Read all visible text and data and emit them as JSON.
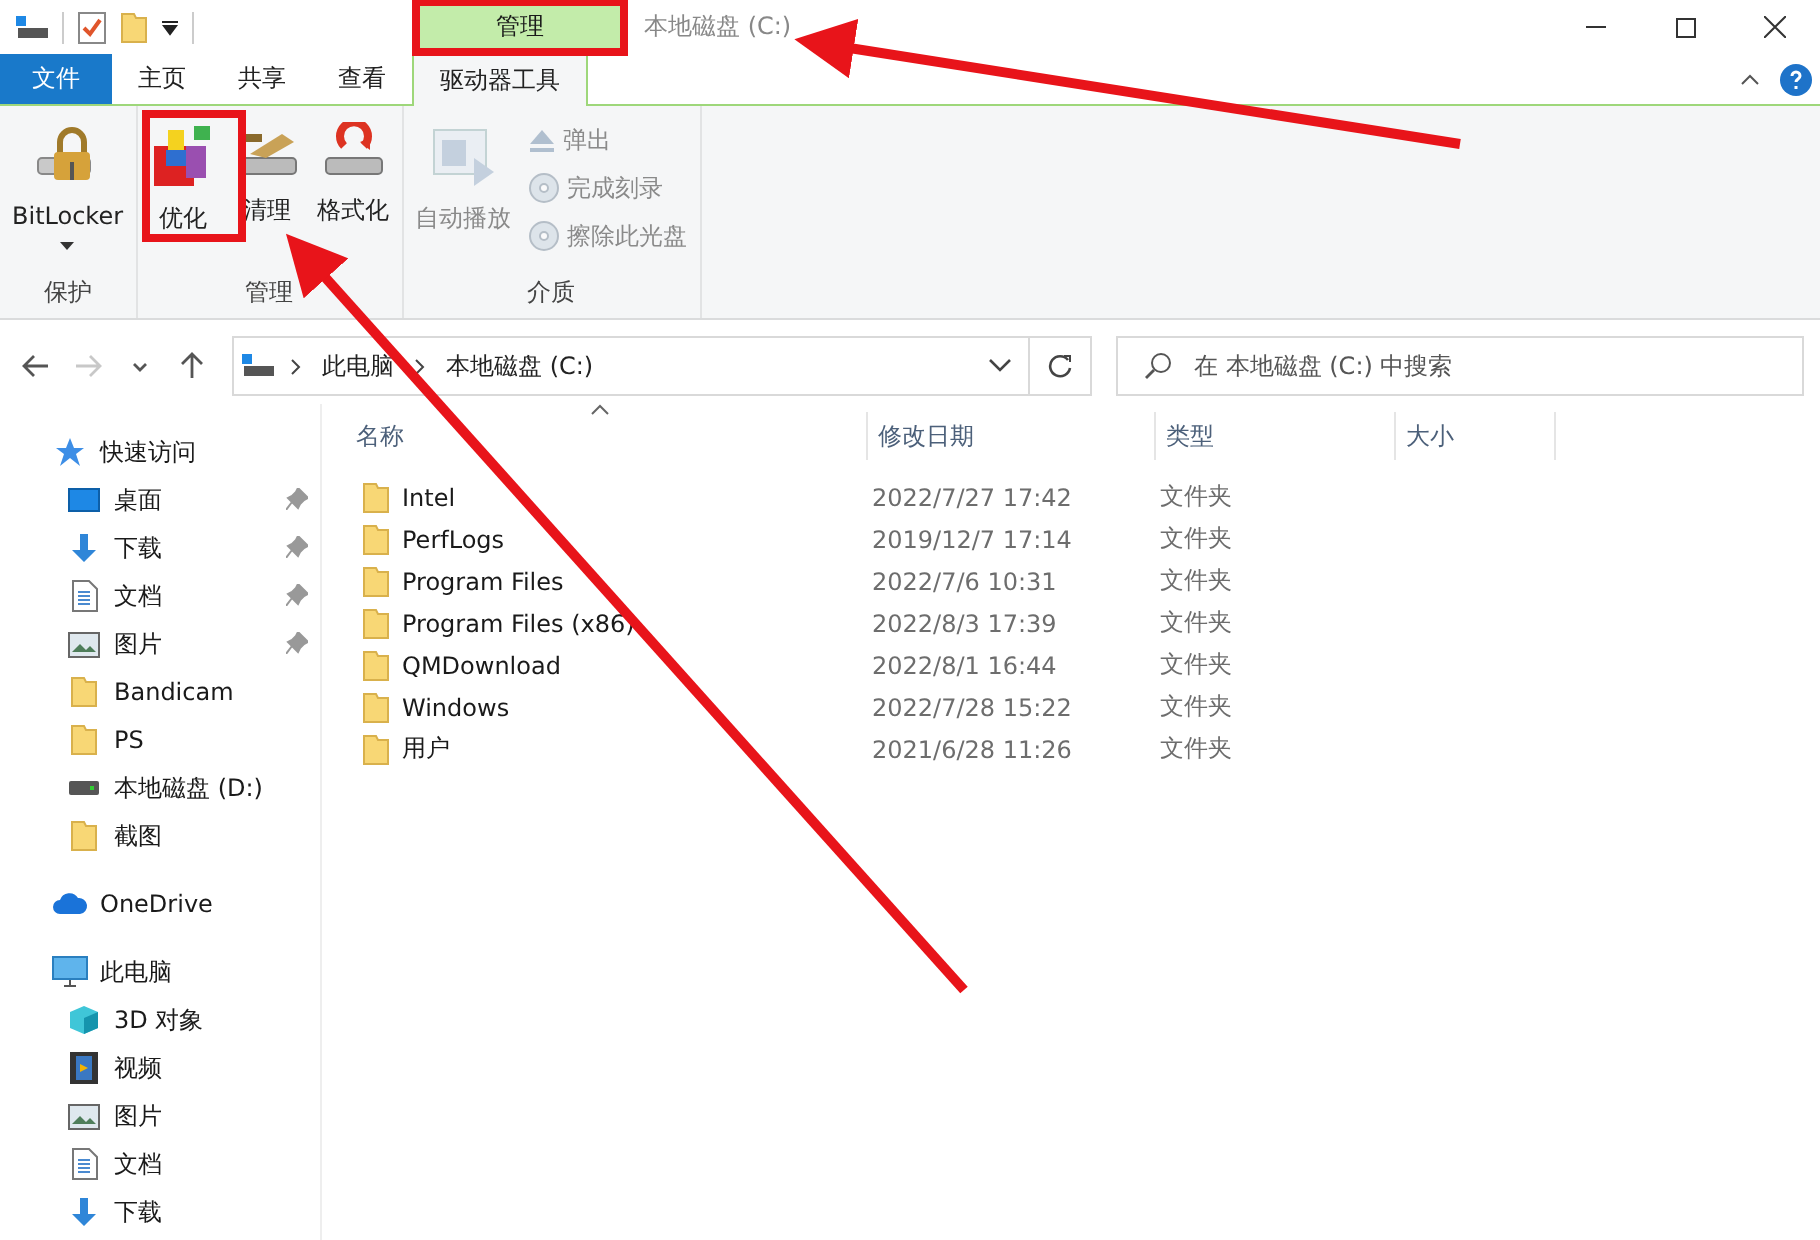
{
  "window": {
    "context_tab": "管理",
    "title": "本地磁盘 (C:)"
  },
  "ribbon": {
    "tabs": [
      {
        "label": "文件",
        "kind": "file",
        "selected": false
      },
      {
        "label": "主页",
        "kind": "tab",
        "selected": false
      },
      {
        "label": "共享",
        "kind": "tab",
        "selected": false
      },
      {
        "label": "查看",
        "kind": "tab",
        "selected": false
      },
      {
        "label": "驱动器工具",
        "kind": "tab",
        "selected": true
      }
    ],
    "groups": [
      {
        "label": "保护",
        "items": [
          {
            "label": "BitLocker",
            "kind": "large",
            "disabled": false,
            "dropdown": true
          }
        ]
      },
      {
        "label": "管理",
        "items": [
          {
            "label": "优化",
            "kind": "large",
            "disabled": false
          },
          {
            "label": "清理",
            "kind": "large",
            "disabled": false
          },
          {
            "label": "格式化",
            "kind": "large",
            "disabled": false
          }
        ]
      },
      {
        "label": "介质",
        "items": [
          {
            "label": "自动播放",
            "kind": "large",
            "disabled": true
          },
          {
            "label": "弹出",
            "kind": "small",
            "disabled": true
          },
          {
            "label": "完成刻录",
            "kind": "small",
            "disabled": true
          },
          {
            "label": "擦除此光盘",
            "kind": "small",
            "disabled": true
          }
        ]
      }
    ]
  },
  "address": {
    "nav": [
      {
        "kind": "back",
        "disabled": false
      },
      {
        "kind": "forward",
        "disabled": true
      },
      {
        "kind": "recent",
        "disabled": false
      },
      {
        "kind": "up",
        "disabled": false
      }
    ],
    "path": [
      "此电脑",
      "本地磁盘 (C:)"
    ],
    "search": {
      "placeholder": "在 本地磁盘 (C:) 中搜索"
    }
  },
  "sidebar": {
    "items": [
      {
        "label": "快速访问",
        "kind": "quick-access",
        "children": [
          {
            "label": "桌面",
            "kind": "desktop",
            "pinned": true
          },
          {
            "label": "下载",
            "kind": "downloads",
            "pinned": true
          },
          {
            "label": "文档",
            "kind": "documents",
            "pinned": true
          },
          {
            "label": "图片",
            "kind": "pictures",
            "pinned": true
          },
          {
            "label": "Bandicam",
            "kind": "folder",
            "pinned": false
          },
          {
            "label": "PS",
            "kind": "folder",
            "pinned": false
          },
          {
            "label": "本地磁盘 (D:)",
            "kind": "drive",
            "pinned": false
          },
          {
            "label": "截图",
            "kind": "folder",
            "pinned": false
          }
        ]
      },
      {
        "label": "OneDrive",
        "kind": "cloud"
      },
      {
        "label": "此电脑",
        "kind": "computer",
        "children": [
          {
            "label": "3D 对象",
            "kind": "objects3d",
            "pinned": false
          },
          {
            "label": "视频",
            "kind": "videos",
            "pinned": false
          },
          {
            "label": "图片",
            "kind": "pictures",
            "pinned": false
          },
          {
            "label": "文档",
            "kind": "documents",
            "pinned": false
          },
          {
            "label": "下载",
            "kind": "downloads",
            "pinned": false
          }
        ]
      }
    ]
  },
  "table": {
    "columns": [
      {
        "label": "名称",
        "sorted": true
      },
      {
        "label": "修改日期",
        "sorted": false
      },
      {
        "label": "类型",
        "sorted": false
      },
      {
        "label": "大小",
        "sorted": false
      }
    ],
    "rows": [
      {
        "name": "Intel",
        "modified": "2022/7/27 17:42",
        "type": "文件夹"
      },
      {
        "name": "PerfLogs",
        "modified": "2019/12/7 17:14",
        "type": "文件夹"
      },
      {
        "name": "Program Files",
        "modified": "2022/7/6 10:31",
        "type": "文件夹"
      },
      {
        "name": "Program Files (x86)",
        "modified": "2022/8/3 17:39",
        "type": "文件夹"
      },
      {
        "name": "QMDownload",
        "modified": "2022/8/1 16:44",
        "type": "文件夹"
      },
      {
        "name": "Windows",
        "modified": "2022/7/28 15:22",
        "type": "文件夹"
      },
      {
        "name": "用户",
        "modified": "2021/6/28 11:26",
        "type": "文件夹"
      }
    ]
  }
}
